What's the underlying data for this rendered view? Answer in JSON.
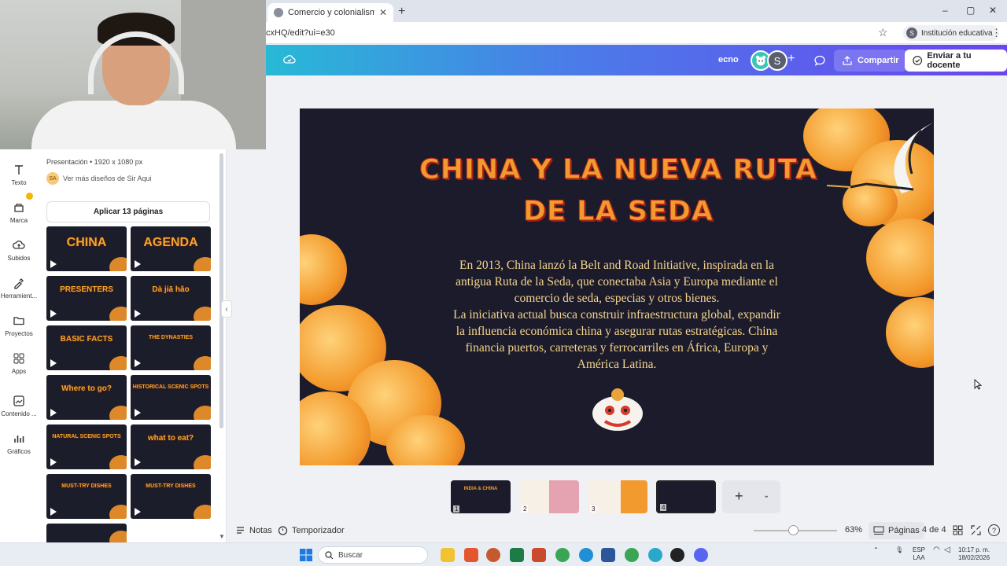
{
  "browser": {
    "tab_title": "Comercio y colonialismo en Ind",
    "url": "cxHQ/edit?ui=e30",
    "profile_initial": "S",
    "profile_label": "Institución educativa",
    "new_tab": "+",
    "win_min": "–",
    "win_max": "▢",
    "win_close": "✕",
    "kebab": "⋮"
  },
  "header": {
    "title_fragment": "ecno",
    "collaborator_initial": "S",
    "add_label": "+",
    "share_label": "Compartir",
    "send_label": "Enviar a tu docente"
  },
  "rail": {
    "items": [
      {
        "label": "Texto",
        "icon": "text-icon"
      },
      {
        "label": "Marca",
        "icon": "brand-icon"
      },
      {
        "label": "Subidos",
        "icon": "upload-icon"
      },
      {
        "label": "Herramient...",
        "icon": "tools-icon"
      },
      {
        "label": "Proyectos",
        "icon": "folder-icon"
      },
      {
        "label": "Apps",
        "icon": "apps-icon"
      },
      {
        "label": "Contenido ...",
        "icon": "content-icon"
      },
      {
        "label": "Gráficos",
        "icon": "charts-icon"
      }
    ]
  },
  "panel": {
    "meta": "Presentación • 1920 x 1080 px",
    "user_initials": "SA",
    "user_link": "Ver más diseños de Sir Aqui",
    "apply_button": "Aplicar 13 páginas",
    "thumbnails": [
      {
        "title": "CHINA"
      },
      {
        "title": "AGENDA"
      },
      {
        "title": "PRESENTERS"
      },
      {
        "title": "Dà jiā hǎo"
      },
      {
        "title": "BASIC FACTS"
      },
      {
        "title": "THE DYNASTIES"
      },
      {
        "title": "Where to go?"
      },
      {
        "title": "HISTORICAL SCENIC SPOTS"
      },
      {
        "title": "NATURAL SCENIC SPOTS"
      },
      {
        "title": "what to eat?"
      },
      {
        "title": "MUST-TRY DISHES"
      },
      {
        "title": "MUST-TRY DISHES"
      },
      {
        "title": ""
      }
    ]
  },
  "slide": {
    "title_line1": "CHINA Y LA NUEVA RUTA",
    "title_line2": "DE LA SEDA",
    "body_line1": "En 2013, China lanzó la Belt and Road Initiative, inspirada en la",
    "body_line2": "antigua Ruta de la Seda, que conectaba Asia y Europa mediante el",
    "body_line3": "comercio de seda, especias y otros bienes.",
    "body_line4": "La iniciativa actual busca construir infraestructura global, expandir",
    "body_line5": "la influencia económica china y asegurar rutas estratégicas. China",
    "body_line6": "financia puertos, carreteras y ferrocarriles en África, Europa y",
    "body_line7": "América Latina."
  },
  "strip": {
    "pages": [
      {
        "num": "1",
        "label": "INDIA & CHINA"
      },
      {
        "num": "2",
        "label": ""
      },
      {
        "num": "3",
        "label": ""
      },
      {
        "num": "4",
        "label": ""
      }
    ],
    "add_label": "+",
    "more_label": "⌄"
  },
  "bottom": {
    "notes_label": "Notas",
    "timer_label": "Temporizador",
    "zoom_value": "63%",
    "zoom_fraction": 0.5,
    "pages_label": "Páginas",
    "page_count": "4 de 4",
    "help": "?"
  },
  "taskbar": {
    "search_placeholder": "Buscar",
    "lang": "ESP",
    "region": "LAA",
    "time": "10:17 p. m.",
    "date": "18/02/2026"
  },
  "colors": {
    "slide_bg": "#1c1b2b",
    "title_orange": "#f29a2e",
    "body_gold": "#f3d58d",
    "cloud_orange": "#f39a2c"
  }
}
